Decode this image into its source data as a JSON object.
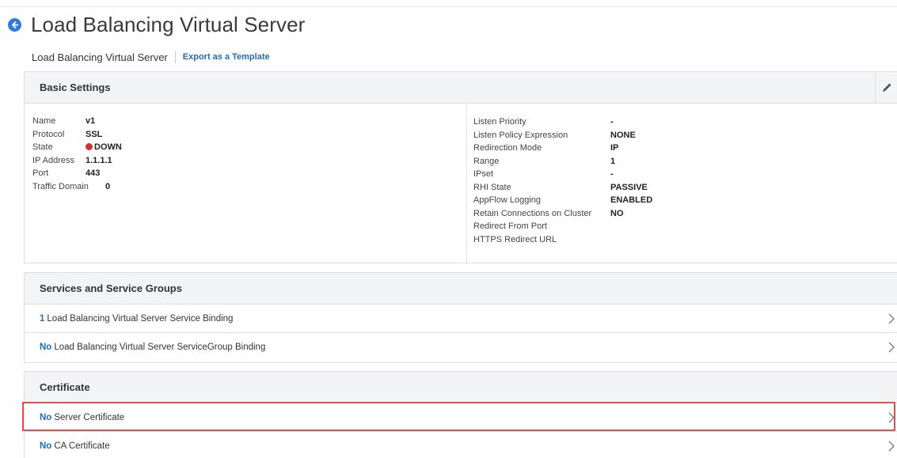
{
  "header": {
    "title": "Load Balancing Virtual Server"
  },
  "subheader": {
    "title": "Load Balancing Virtual Server",
    "export_link": "Export as a Template"
  },
  "basic_settings": {
    "heading": "Basic Settings",
    "left": [
      {
        "key": "Name",
        "value": "v1"
      },
      {
        "key": "Protocol",
        "value": "SSL"
      },
      {
        "key": "State",
        "value": "DOWN",
        "status_color": "#d32f2f"
      },
      {
        "key": "IP Address",
        "value": "1.1.1.1"
      },
      {
        "key": "Port",
        "value": "443"
      },
      {
        "key": "Traffic Domain",
        "value": "0"
      }
    ],
    "right": [
      {
        "key": "Listen Priority",
        "value": "-"
      },
      {
        "key": "Listen Policy Expression",
        "value": "NONE"
      },
      {
        "key": "Redirection Mode",
        "value": "IP"
      },
      {
        "key": "Range",
        "value": "1"
      },
      {
        "key": "IPset",
        "value": "-"
      },
      {
        "key": "RHI State",
        "value": "PASSIVE"
      },
      {
        "key": "AppFlow Logging",
        "value": "ENABLED"
      },
      {
        "key": "Retain Connections on Cluster",
        "value": "NO"
      },
      {
        "key": "Redirect From Port",
        "value": ""
      },
      {
        "key": "HTTPS Redirect URL",
        "value": ""
      }
    ]
  },
  "services": {
    "heading": "Services and Service Groups",
    "rows": [
      {
        "count": "1",
        "label": "Load Balancing Virtual Server Service Binding"
      },
      {
        "count": "No",
        "label": "Load Balancing Virtual Server ServiceGroup Binding"
      }
    ]
  },
  "certificate": {
    "heading": "Certificate",
    "rows": [
      {
        "count": "No",
        "label": "Server Certificate"
      },
      {
        "count": "No",
        "label": "CA Certificate"
      }
    ]
  },
  "colors": {
    "accent": "#1f6db6",
    "back_icon": "#2e7dd7",
    "highlight": "#d9534f",
    "status_down": "#d32f2f"
  }
}
